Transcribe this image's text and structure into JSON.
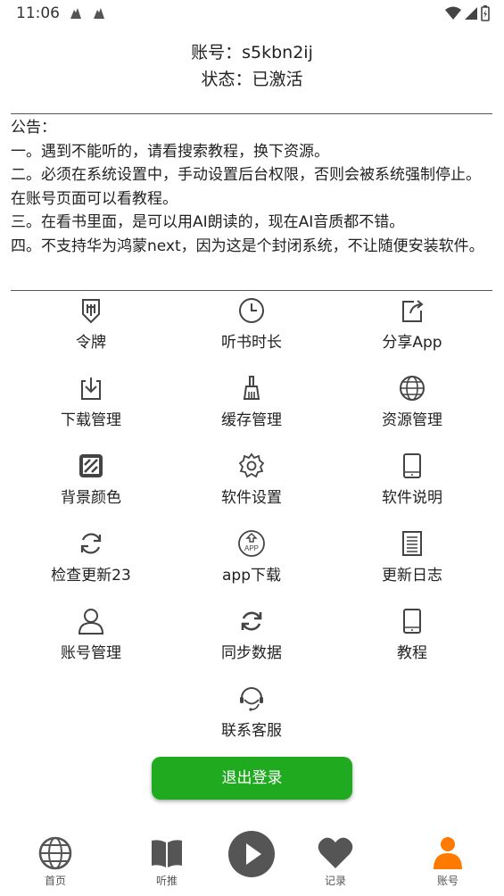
{
  "status_bar": {
    "time": "11:06"
  },
  "account": {
    "account_line": "账号：s5kbn2ij",
    "status_line": "状态：已激活"
  },
  "notice": {
    "title": "公告：",
    "lines": [
      "一。遇到不能听的，请看搜索教程，换下资源。",
      "二。必须在系统设置中，手动设置后台权限，否则会被系统强制停止。在账号页面可以看教程。",
      "三。在看书里面，是可以用AI朗读的，现在AI音质都不错。",
      "四。不支持华为鸿蒙next，因为这是个封闭系统，不让随便安装软件。"
    ]
  },
  "menu": [
    {
      "label": "令牌",
      "icon": "token-icon"
    },
    {
      "label": "听书时长",
      "icon": "clock-icon"
    },
    {
      "label": "分享App",
      "icon": "share-icon"
    },
    {
      "label": "下载管理",
      "icon": "download-icon"
    },
    {
      "label": "缓存管理",
      "icon": "broom-icon"
    },
    {
      "label": "资源管理",
      "icon": "globe-icon"
    },
    {
      "label": "背景颜色",
      "icon": "pattern-icon"
    },
    {
      "label": "软件设置",
      "icon": "gear-icon"
    },
    {
      "label": "软件说明",
      "icon": "tablet-icon"
    },
    {
      "label": "检查更新23",
      "icon": "refresh-icon"
    },
    {
      "label": "app下载",
      "icon": "app-download-icon"
    },
    {
      "label": "更新日志",
      "icon": "document-icon"
    },
    {
      "label": "账号管理",
      "icon": "user-icon"
    },
    {
      "label": "同步数据",
      "icon": "sync-icon"
    },
    {
      "label": "教程",
      "icon": "tablet-icon"
    },
    {
      "label": "联系客服",
      "icon": "headset-icon"
    }
  ],
  "logout": {
    "label": "退出登录",
    "color": "#1faa1f"
  },
  "bottom_nav": [
    {
      "label": "首页",
      "icon": "globe-icon"
    },
    {
      "label": "听推",
      "icon": "book-icon"
    },
    {
      "label": "",
      "icon": "play-icon"
    },
    {
      "label": "记录",
      "icon": "heart-icon"
    },
    {
      "label": "账号",
      "icon": "person-icon",
      "active": true,
      "color": "#ff7a00"
    }
  ]
}
